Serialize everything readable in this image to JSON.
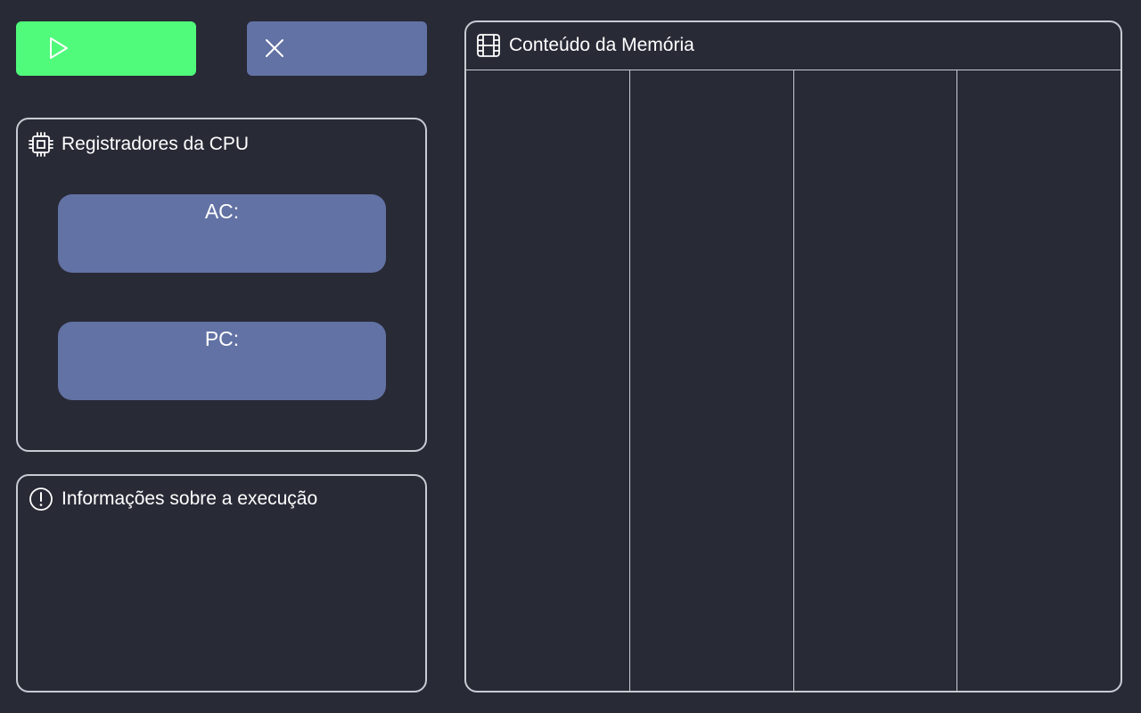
{
  "toolbar": {
    "run_button": {
      "label": "",
      "icon": "play-icon",
      "color": "#50fa7b"
    },
    "stop_button": {
      "label": "",
      "icon": "close-icon",
      "color": "#6272a4"
    }
  },
  "registers_panel": {
    "title": "Registradores da CPU",
    "icon": "cpu-chip-icon",
    "registers": [
      {
        "label": "AC:",
        "value": ""
      },
      {
        "label": "PC:",
        "value": ""
      }
    ]
  },
  "execution_panel": {
    "title": "Informações sobre a execução",
    "icon": "alert-circle-icon",
    "content": ""
  },
  "memory_panel": {
    "title": "Conteúdo da Memória",
    "icon": "film-icon",
    "columns": [
      "",
      "",
      "",
      ""
    ]
  },
  "colors": {
    "background": "#282a36",
    "accent_green": "#50fa7b",
    "accent_blue": "#6272a4",
    "border": "#c9cbd3"
  }
}
